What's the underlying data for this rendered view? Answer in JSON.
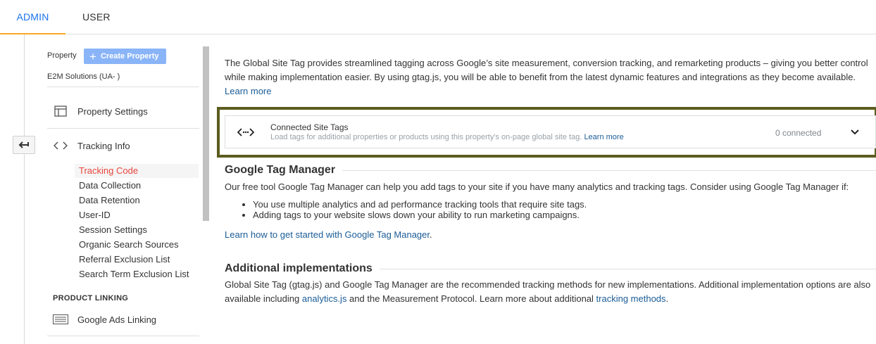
{
  "tabs": [
    {
      "label": "ADMIN",
      "active": true
    },
    {
      "label": "USER",
      "active": false
    }
  ],
  "sidebar": {
    "property_label": "Property",
    "create_property_label": "Create Property",
    "account_name": "E2M Solutions (UA-                    )",
    "property_settings": "Property Settings",
    "tracking_info": "Tracking Info",
    "tracking_sub": [
      {
        "label": "Tracking Code",
        "active": true
      },
      {
        "label": "Data Collection"
      },
      {
        "label": "Data Retention"
      },
      {
        "label": "User-ID"
      },
      {
        "label": "Session Settings"
      },
      {
        "label": "Organic Search Sources"
      },
      {
        "label": "Referral Exclusion List"
      },
      {
        "label": "Search Term Exclusion List"
      }
    ],
    "product_linking_label": "PRODUCT LINKING",
    "google_ads_linking": "Google Ads Linking"
  },
  "main": {
    "intro_text": "The Global Site Tag provides streamlined tagging across Google’s site measurement, conversion tracking, and remarketing products – giving you better control while making implementation easier. By using gtag.js, you will be able to benefit from the latest dynamic features and integrations as they become available.",
    "intro_link": "Learn more",
    "connected_tags": {
      "title": "Connected Site Tags",
      "description": "Load tags for additional properties or products using this property's on-page global site tag.",
      "learn_more": "Learn more",
      "status": "0 connected"
    },
    "gtm": {
      "heading": "Google Tag Manager",
      "text": "Our free tool Google Tag Manager can help you add tags to your site if you have many analytics and tracking tags. Consider using Google Tag Manager if:",
      "bullets": [
        "You use multiple analytics and ad performance tracking tools that require site tags.",
        "Adding tags to your website slows down your ability to run marketing campaigns."
      ],
      "link": "Learn how to get started with Google Tag Manager",
      "link_suffix": "."
    },
    "additional": {
      "heading": "Additional implementations",
      "text_1": "Global Site Tag (gtag.js) and Google Tag Manager are the recommended tracking methods for new implementations. Additional implementation options are also available including ",
      "link_1": "analytics.js",
      "text_2": " and the Measurement Protocol. Learn more about additional ",
      "link_2": "tracking methods",
      "text_3": "."
    }
  },
  "colors": {
    "accent_blue": "#1a73e8",
    "tab_underline": "#f9a825",
    "active_sub": "#e8453c",
    "highlight_border": "#5c5c1f"
  }
}
